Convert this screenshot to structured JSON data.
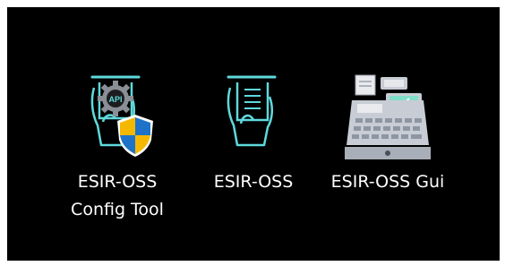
{
  "desktop": {
    "background": "#000000",
    "shortcuts": [
      {
        "line1": "ESIR-OSS",
        "line2": "Config Tool",
        "icon": "receipt-hand-api-shield-icon"
      },
      {
        "line1": "ESIR-OSS",
        "icon": "receipt-hand-icon"
      },
      {
        "line1": "ESIR-OSS Gui",
        "icon": "cash-register-icon"
      }
    ]
  },
  "colors": {
    "accent_cyan": "#5fd9dc",
    "shield_blue": "#1e73c8",
    "shield_yellow": "#f5b800",
    "register_gray": "#c8ccd4"
  }
}
